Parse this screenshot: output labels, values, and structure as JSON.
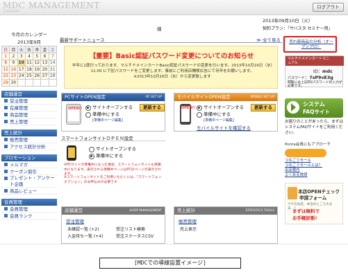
{
  "header": {
    "brand": "MDC MANAGEMENT",
    "brand_sub": "SAVAWAY",
    "logout": "ログアウト"
  },
  "subbar": {
    "sama": "様",
    "plan": "契約プラン：「サバスタ セミナー用」",
    "date": "2013年09月10日（火）"
  },
  "calendar": {
    "title": "今月のカレンダー",
    "month": "2013年9月",
    "weekdays": [
      "日",
      "月",
      "火",
      "水",
      "木",
      "金",
      "土"
    ],
    "rows": [
      [
        "1",
        "2",
        "3",
        "4",
        "5",
        "6",
        "7"
      ],
      [
        "8",
        "9",
        "10",
        "11",
        "12",
        "13",
        "14"
      ],
      [
        "15",
        "16",
        "17",
        "18",
        "19",
        "20",
        "21"
      ],
      [
        "22",
        "23",
        "24",
        "25",
        "26",
        "27",
        "28"
      ],
      [
        "29",
        "30",
        "",
        "",
        "",
        "",
        ""
      ]
    ],
    "today": "10"
  },
  "nav": [
    {
      "title": "店舗運営",
      "items": [
        "受注管理",
        "在庫管理",
        "商品管理",
        "売上管理"
      ]
    },
    {
      "title": "売上統計",
      "items": [
        "販売管理",
        "アクセス統計分析"
      ]
    },
    {
      "title": "プロモーション",
      "items": [
        "メルマガ",
        "クーポン割引",
        "プレゼント・アンケート企画",
        "商品レビュー"
      ]
    },
    {
      "title": "会員管理",
      "items": [
        "会員管理",
        "会員ランク"
      ]
    }
  ],
  "news": {
    "title": "最新サポートニュース",
    "more": "≫ 全て見る",
    "notice_title": "【重要】Basic認証パスワード変更についてのお知らせ",
    "notice_body": "半年に1度行っております、マルチドメインカートBasic認証パスワードの変更を行います。2013年10月16日（水）11:00 に下記パスワードをご変更します。事前にご利用店舗様広告にて何卒をお願いします。",
    "notice_tail": "※2013年10月16日（水）から変更致します"
  },
  "pc_site": {
    "header": "PCサイトOPEN設定",
    "header_en": "PC SET UP",
    "open_label": "サイトオープンする",
    "prep_label": "準備中にする",
    "update": "更新する",
    "edit_link": "[準備中ページ編集]",
    "banner": "OPEN!!"
  },
  "mobile_site": {
    "header": "モバイルサイトOPEN設定",
    "header_en": "MOBILE SET UP",
    "open_label": "サイトオープンする",
    "prep_label": "準備中にする",
    "update": "更新する",
    "edit_link": "[準備中ページ編集]",
    "banner": "OPEN!!",
    "preview": "モバイルサイトを確認する"
  },
  "smartphone": {
    "title": "スマートフォンサイトＯＰＥＮ設定",
    "open_label": "サイトオープンする",
    "prep_label": "準備中にする",
    "note1": "※PCサイトが準備中になった場合、スマートフォンサイトも準備中になります。表示される準備中ページはPCのページが表示されます。",
    "note2": "※スマートフォンサイトをご利用いただくには、「スマートフォンオプション」のお申込みが必要です"
  },
  "shop_ops": {
    "header": "店舗運営",
    "header_en": "SHOP MANAGEMENT",
    "link": "受注管理",
    "items": [
      "未確認一覧 (+2)",
      "受注リスト検索",
      "入金待ち一覧 (+4)",
      "受注ステータスCSV"
    ]
  },
  "sales_stats": {
    "header": "売上統計",
    "header_en": "STATISTICS TOOLS",
    "link": "販売管理",
    "item": "売上表示"
  },
  "right": {
    "analysis": "売れ筋商品の分析（オープンプロ）",
    "mobile_head": "マルチドメインカートマニュアル",
    "id_label": "ID",
    "id_value": "mdc",
    "pw_label": "パスワード",
    "pw_value": "7sP9vE3g",
    "mobile_note": "閲覧には上記ID/パスワードの入力が必要です。",
    "faq1": "システム",
    "faq2": "FAQサイト",
    "faq_desc": "お困りのことがあったら、まずはシステムFAQサイトをご利用ください。",
    "ponta_head": "Ponta会員にもアプローチ",
    "ponta_link1": "つなごうモール",
    "ponta_link2": "つなごうモールとは？",
    "ponta_link3": "出店案内",
    "ponta_link4": "よくある質問",
    "shop_t1": "本店OPENチェック",
    "shop_t2": "申請フォーム",
    "shop_t3": "ウチのお店、本当のところ大丈夫…？",
    "shop_t4": "まずは無料で",
    "shop_t5": "お手軽診断!"
  },
  "caption": "[MDCでの導線設置イメージ]"
}
